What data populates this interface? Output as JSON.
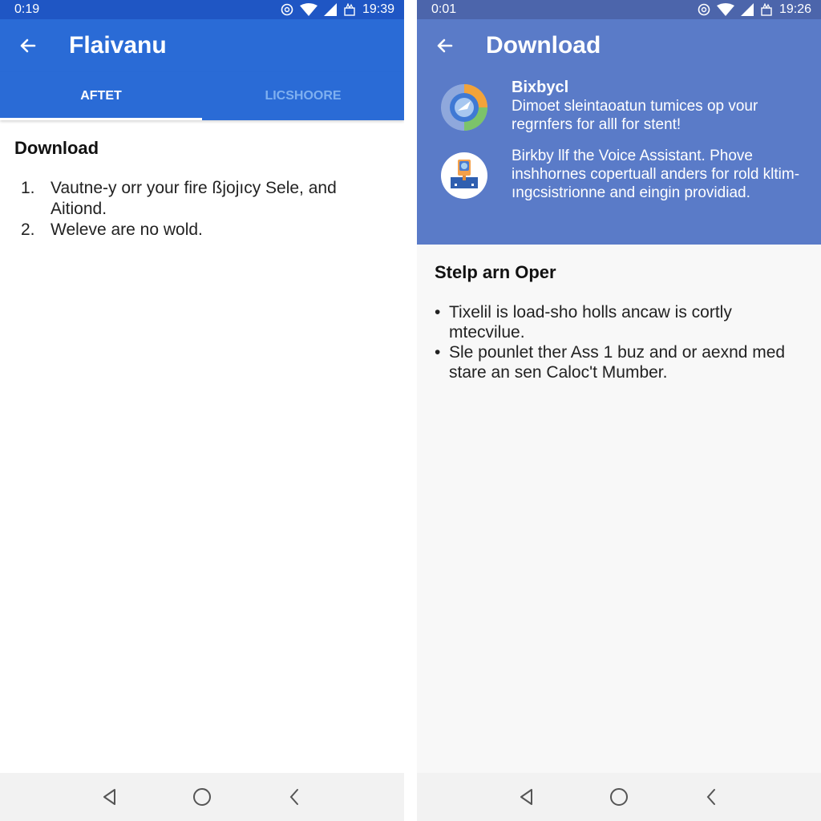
{
  "left_screen": {
    "status_bar": {
      "time_left": "0:19",
      "time_right": "19:39"
    },
    "app_bar": {
      "title": "Flaivanu",
      "back_icon": "arrow-left-icon"
    },
    "tabs": [
      {
        "label": "AFTET",
        "active": true
      },
      {
        "label": "LICSHOORE",
        "active": false
      }
    ],
    "section_title": "Download",
    "steps": [
      {
        "num": "1.",
        "text": "Vautne-y orr your fire ßjojıcy Sele, and Aitiond."
      },
      {
        "num": "2.",
        "text": "Weleve are no wold."
      }
    ],
    "nav": [
      "back-triangle-icon",
      "home-circle-icon",
      "recents-chevron-icon"
    ]
  },
  "right_screen": {
    "status_bar": {
      "time_left": "0:01",
      "time_right": "19:26"
    },
    "app_bar": {
      "title": "Download",
      "back_icon": "arrow-left-icon"
    },
    "banner": [
      {
        "icon": "bixby-chart-icon",
        "title": "Bixbycl",
        "text": "Dimoet sleintaoatun tumices op vour regrnfers for alll for stent!"
      },
      {
        "icon": "assistant-device-icon",
        "title": "",
        "text": "Birkby llf the Voice Assistant. Phove inshhornes copertuall anders for rold kltim-ıngcsistrionne and eingin providiad."
      }
    ],
    "section_title": "Stelp arn Oper",
    "bullets": [
      {
        "text": "Tixelil is load-sho holls ancaw is cortly mtecvilue."
      },
      {
        "text": "Sle pounlet ther Ass 1 buz and or aexnd med stare an sen Caloc't Mumber."
      }
    ],
    "nav": [
      "back-triangle-icon",
      "home-circle-icon",
      "recents-chevron-icon"
    ]
  },
  "colors": {
    "left_primary": "#2a6bd6",
    "left_status": "#1f56c4",
    "right_primary": "#5a7bc8",
    "right_status": "#4c65ab",
    "inactive_tab": "#7fb0f0",
    "navbar_bg": "#f2f2f2"
  }
}
